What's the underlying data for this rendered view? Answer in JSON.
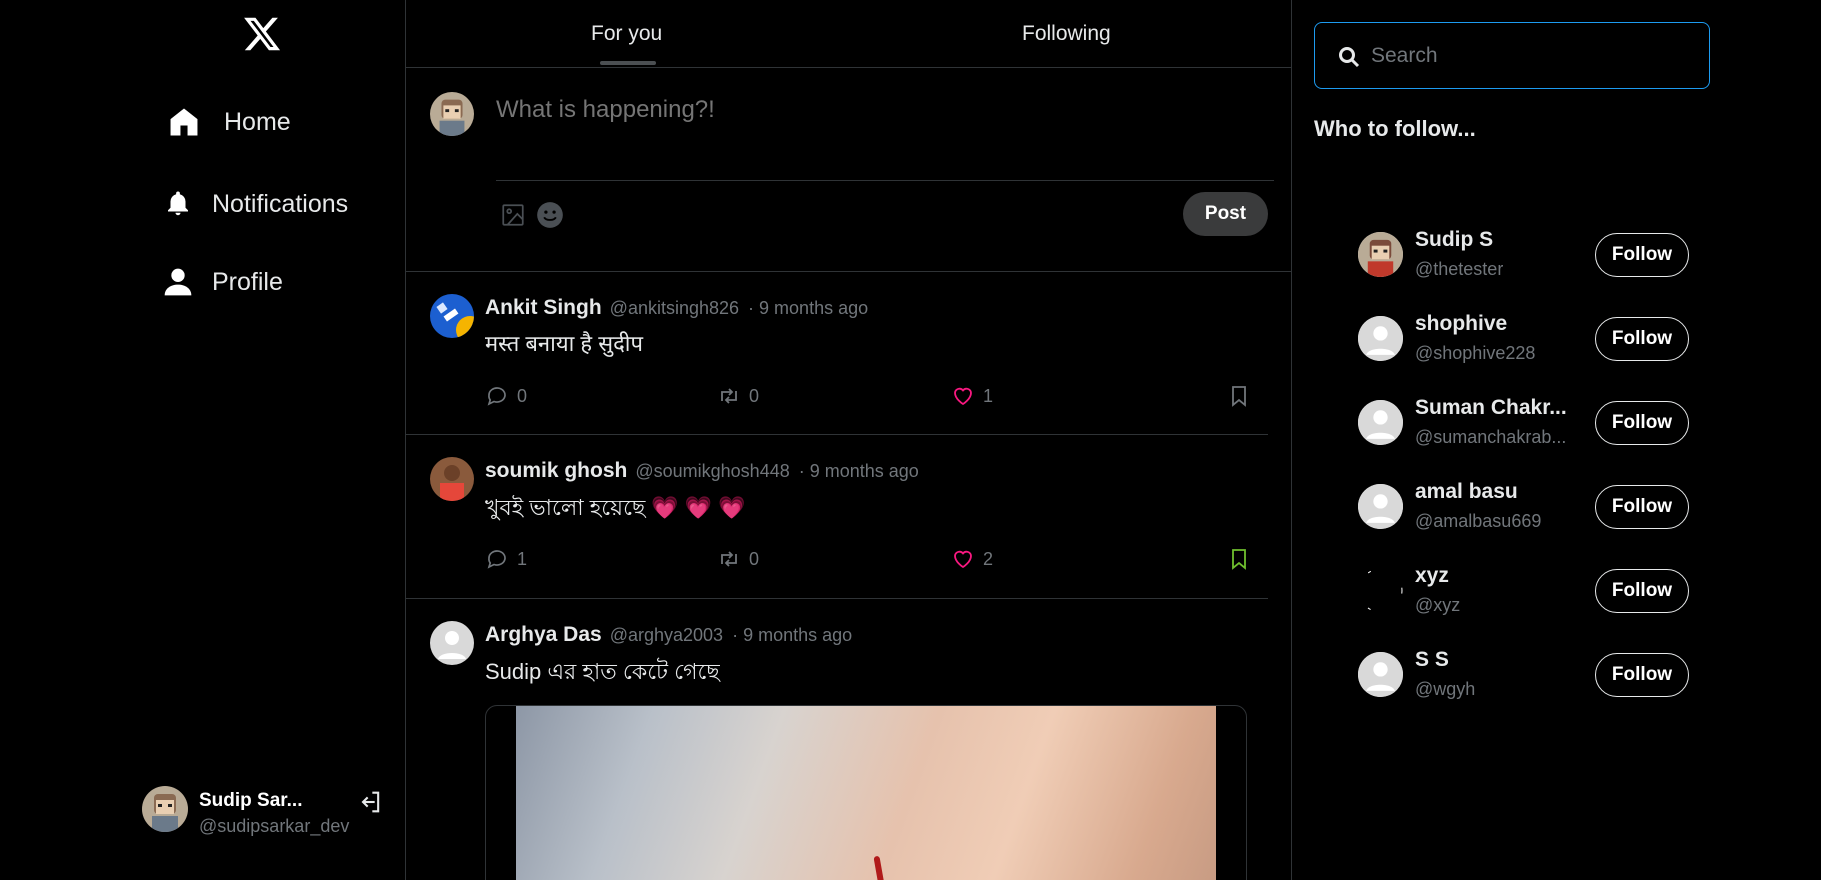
{
  "sidebar": {
    "logo": "x-logo",
    "nav": [
      {
        "label": "Home",
        "icon": "home-icon"
      },
      {
        "label": "Notifications",
        "icon": "bell-icon"
      },
      {
        "label": "Profile",
        "icon": "person-icon"
      }
    ],
    "account": {
      "name": "Sudip Sar...",
      "handle": "@sudipsarkar_dev"
    }
  },
  "tabs": [
    {
      "label": "For you",
      "active": true
    },
    {
      "label": "Following",
      "active": false
    }
  ],
  "composer": {
    "placeholder": "What is happening?!",
    "post_label": "Post"
  },
  "tweets": [
    {
      "name": "Ankit Singh",
      "handle": "@ankitsingh826",
      "time": "· 9 months ago",
      "text": "मस्त बनाया है  सुदीप",
      "replies": "0",
      "retweets": "0",
      "likes": "1",
      "bookmarked": false
    },
    {
      "name": "soumik ghosh",
      "handle": "@soumikghosh448",
      "time": "· 9 months ago",
      "text": "খুবই ভালো হয়েছে 💗 💗 💗",
      "replies": "1",
      "retweets": "0",
      "likes": "2",
      "bookmarked": true
    },
    {
      "name": "Arghya Das",
      "handle": "@arghya2003",
      "time": "· 9 months ago",
      "text": "Sudip এর হাত কেটে গেছে"
    }
  ],
  "right": {
    "search_placeholder": "Search",
    "who_to_follow": "Who to follow...",
    "follow_label": "Follow",
    "suggestions": [
      {
        "name": "Sudip S",
        "handle": "@thetester"
      },
      {
        "name": "shophive",
        "handle": "@shophive228"
      },
      {
        "name": "Suman Chakr...",
        "handle": "@sumanchakrab..."
      },
      {
        "name": "amal basu",
        "handle": "@amalbasu669"
      },
      {
        "name": "xyz",
        "handle": "@xyz"
      },
      {
        "name": "S S",
        "handle": "@wgyh"
      }
    ]
  },
  "colors": {
    "background": "#000000",
    "border": "#2f3336",
    "muted": "#71767b",
    "like": "#f91880",
    "bookmark_active": "#6fbf2e",
    "search_border": "#1d9bf0"
  }
}
